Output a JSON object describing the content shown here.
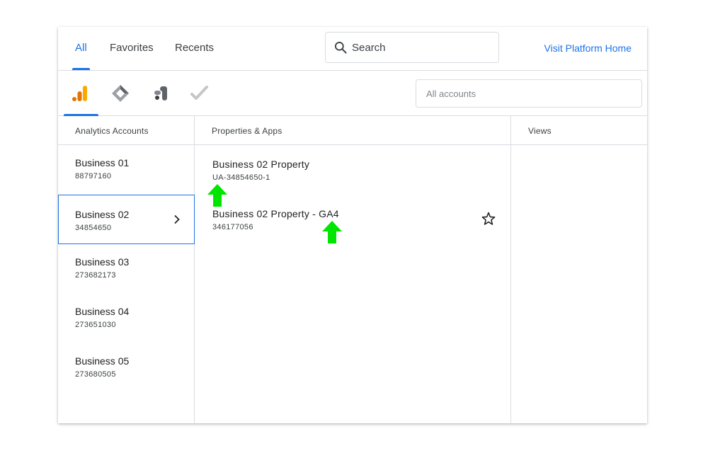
{
  "tabs": [
    {
      "label": "All"
    },
    {
      "label": "Favorites"
    },
    {
      "label": "Recents"
    }
  ],
  "search": {
    "label": "Search"
  },
  "visit_link": "Visit Platform Home",
  "products": [
    {
      "icon": "analytics-icon"
    },
    {
      "icon": "tag-manager-icon"
    },
    {
      "icon": "data-studio-icon"
    },
    {
      "icon": "optimize-icon"
    }
  ],
  "account_filter": {
    "placeholder": "All accounts"
  },
  "columns": {
    "accounts": "Analytics Accounts",
    "properties": "Properties & Apps",
    "views": "Views"
  },
  "accounts": [
    {
      "name": "Business 01",
      "id": "88797160"
    },
    {
      "name": "Business 02",
      "id": "34854650"
    },
    {
      "name": "Business 03",
      "id": "273682173"
    },
    {
      "name": "Business 04",
      "id": "273651030"
    },
    {
      "name": "Business 05",
      "id": "273680505"
    }
  ],
  "properties": [
    {
      "name": "Business 02 Property",
      "id": "UA-34854650-1"
    },
    {
      "name": "Business 02 Property - GA4",
      "id": "346177056"
    }
  ],
  "colors": {
    "accent": "#1a73e8",
    "annotation_arrow": "#00e600"
  }
}
